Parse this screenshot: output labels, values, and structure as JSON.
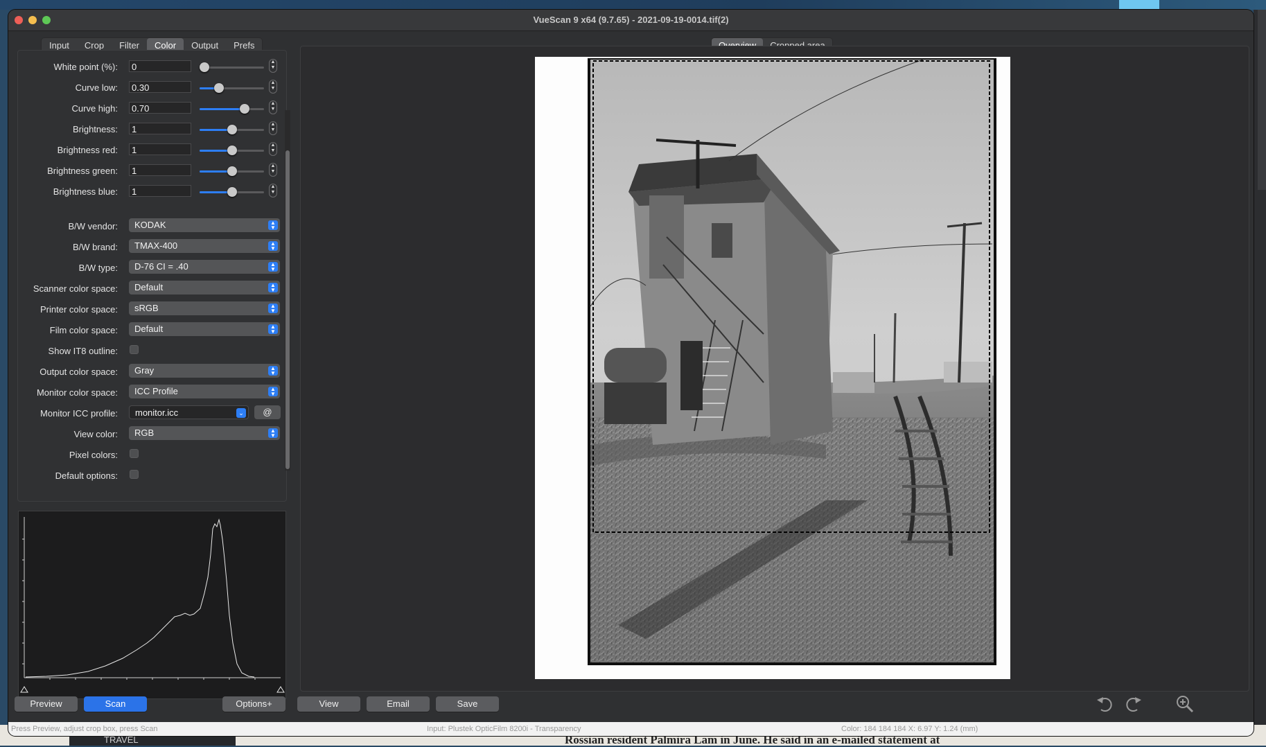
{
  "window": {
    "title": "VueScan 9 x64 (9.7.65) - 2021-09-19-0014.tif(2)"
  },
  "tabs": [
    {
      "label": "Input"
    },
    {
      "label": "Crop"
    },
    {
      "label": "Filter"
    },
    {
      "label": "Color",
      "active": true
    },
    {
      "label": "Output"
    },
    {
      "label": "Prefs"
    }
  ],
  "numeric_fields": [
    {
      "label": "White point (%):",
      "value": "0",
      "slider_fraction": 0.07
    },
    {
      "label": "Curve low:",
      "value": "0.30",
      "slider_fraction": 0.3
    },
    {
      "label": "Curve high:",
      "value": "0.70",
      "slider_fraction": 0.7
    },
    {
      "label": "Brightness:",
      "value": "1",
      "slider_fraction": 0.5
    },
    {
      "label": "Brightness red:",
      "value": "1",
      "slider_fraction": 0.5
    },
    {
      "label": "Brightness green:",
      "value": "1",
      "slider_fraction": 0.5
    },
    {
      "label": "Brightness blue:",
      "value": "1",
      "slider_fraction": 0.5
    }
  ],
  "selects": {
    "bw_vendor": {
      "label": "B/W vendor:",
      "value": "KODAK"
    },
    "bw_brand": {
      "label": "B/W brand:",
      "value": "TMAX-400"
    },
    "bw_type": {
      "label": "B/W type:",
      "value": "D-76 CI = .40"
    },
    "scanner_cs": {
      "label": "Scanner color space:",
      "value": "Default"
    },
    "printer_cs": {
      "label": "Printer color space:",
      "value": "sRGB"
    },
    "film_cs": {
      "label": "Film color space:",
      "value": "Default"
    },
    "output_cs": {
      "label": "Output color space:",
      "value": "Gray"
    },
    "monitor_cs": {
      "label": "Monitor color space:",
      "value": "ICC Profile"
    },
    "monitor_icc": {
      "label": "Monitor ICC profile:",
      "value": "monitor.icc",
      "button": "@"
    },
    "view_color": {
      "label": "View color:",
      "value": "RGB"
    }
  },
  "checkboxes": {
    "show_it8": {
      "label": "Show IT8 outline:",
      "checked": false
    },
    "pixel_colors": {
      "label": "Pixel colors:",
      "checked": false
    },
    "default_options": {
      "label": "Default options:",
      "checked": false
    }
  },
  "view_tabs": [
    {
      "label": "Overview",
      "active": true
    },
    {
      "label": "Cropped area"
    }
  ],
  "buttons": {
    "preview": "Preview",
    "scan": "Scan",
    "options": "Options+",
    "view": "View",
    "email": "Email",
    "save": "Save"
  },
  "status": {
    "left": "Press Preview, adjust crop box, press Scan",
    "center": "Input: Plustek OpticFilm 8200i - Transparency",
    "right": "Color: 184 184 184   X:   6.97   Y:   1.24 (mm)"
  },
  "background": {
    "sidebar_item": "TRAVEL",
    "article_snippet": "Rossian resident   Palmira Lam in June. He said in an e-mailed statement at"
  },
  "colors": {
    "accent": "#2b73e8",
    "window_bg": "#2f3032"
  },
  "icons": [
    "rotate-left-icon",
    "rotate-right-icon",
    "zoom-in-icon"
  ]
}
